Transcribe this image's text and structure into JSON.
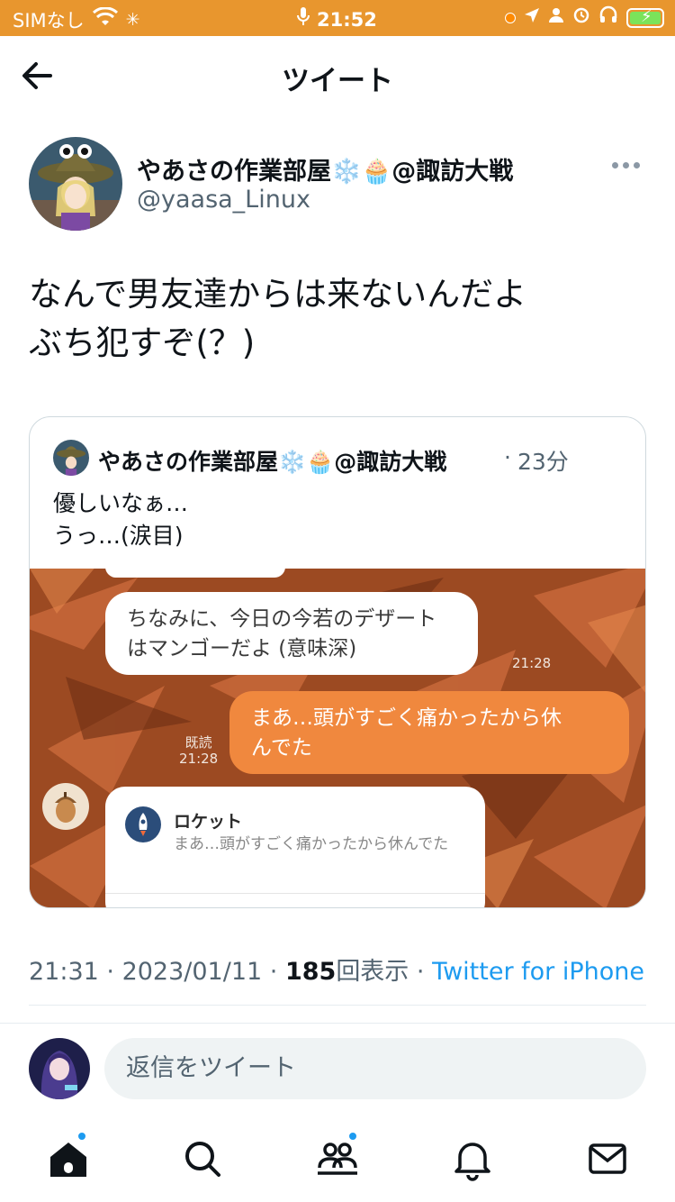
{
  "status_bar": {
    "carrier": "SIMなし",
    "time": "21:52"
  },
  "header": {
    "title": "ツイート"
  },
  "tweet": {
    "author_name": "やあさの作業部屋❄️🧁@諏訪大戦",
    "author_handle": "@yaasa_Linux",
    "text": "なんで男友達からは来ないんだよ\nぶち犯すぞ(？)",
    "quote": {
      "author_name": "やあさの作業部屋❄️🧁@諏訪大戦",
      "separator": "·",
      "time": "23分",
      "text": "優しいなぁ…\nうっ…(涙目)",
      "image": {
        "bubble_1": "ちなみに、今日の今若のデザート\nはマンゴーだよ (意味深)",
        "time_1": "21:28",
        "bubble_2": "まあ…頭がすごく痛かったから休\nんでた",
        "read_label": "既読",
        "time_2": "21:28",
        "share_title": "ロケット",
        "share_text": "まあ…頭がすごく痛かったから休んでた"
      }
    },
    "meta": {
      "time": "21:31",
      "date": "2023/01/11",
      "views_count": "185",
      "views_label": "回表示",
      "source": "Twitter for iPhone"
    }
  },
  "reply": {
    "placeholder": "返信をツイート"
  },
  "tabs": [
    {
      "icon": "home-icon",
      "badge": true
    },
    {
      "icon": "search-icon",
      "badge": false
    },
    {
      "icon": "communities-icon",
      "badge": true
    },
    {
      "icon": "bell-icon",
      "badge": false
    },
    {
      "icon": "mail-icon",
      "badge": false
    }
  ],
  "colors": {
    "status_bar": "#e8962e",
    "accent": "#1d9bf0",
    "chat_bg": "#a84e24",
    "bubble_orange": "#f0883e"
  }
}
